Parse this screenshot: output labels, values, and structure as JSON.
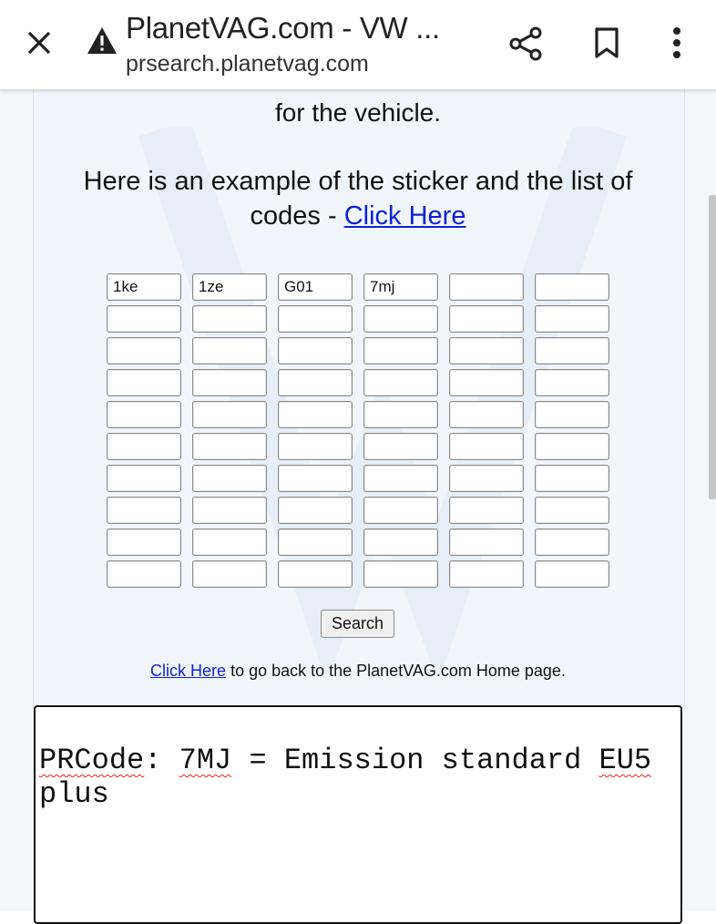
{
  "browser": {
    "title": "PlanetVAG.com - VW ...",
    "url": "prsearch.planetvag.com"
  },
  "page": {
    "intro_tail": "for the vehicle.",
    "example_text": "Here is an example of the sticker and the list of codes - ",
    "example_link": "Click Here",
    "codes": [
      [
        "1ke",
        "1ze",
        "G01",
        "7mj",
        "",
        ""
      ],
      [
        "",
        "",
        "",
        "",
        "",
        ""
      ],
      [
        "",
        "",
        "",
        "",
        "",
        ""
      ],
      [
        "",
        "",
        "",
        "",
        "",
        ""
      ],
      [
        "",
        "",
        "",
        "",
        "",
        ""
      ],
      [
        "",
        "",
        "",
        "",
        "",
        ""
      ],
      [
        "",
        "",
        "",
        "",
        "",
        ""
      ],
      [
        "",
        "",
        "",
        "",
        "",
        ""
      ],
      [
        "",
        "",
        "",
        "",
        "",
        ""
      ],
      [
        "",
        "",
        "",
        "",
        "",
        ""
      ]
    ],
    "search_label": "Search",
    "back_link": "Click Here",
    "back_text": " to go back to the PlanetVAG.com Home page."
  },
  "result": {
    "label": "PRCode",
    "sep1": ": ",
    "code": "7MJ",
    "sep2": " = Emission standard ",
    "standard": "EU5",
    "tail": " plus"
  }
}
